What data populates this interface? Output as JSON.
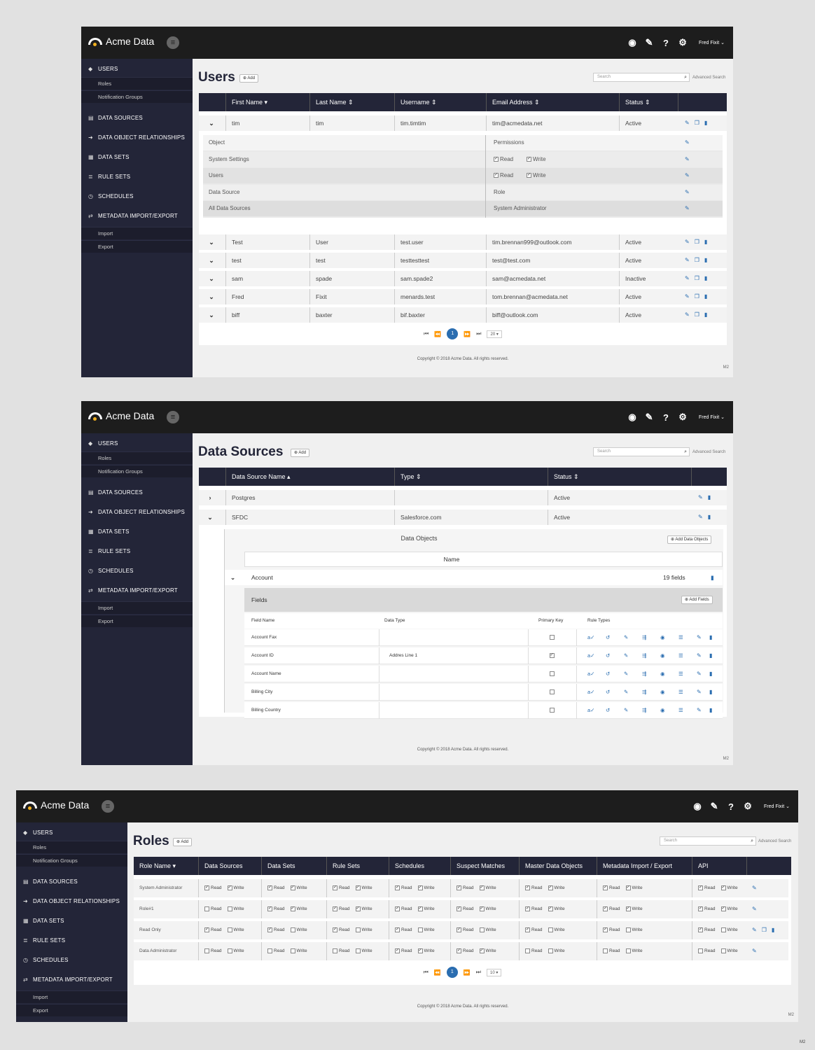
{
  "app": {
    "brand": "Acme Data",
    "user_menu": "Fred Fixit",
    "top_icons": [
      "dashboard-icon",
      "wand-icon",
      "help-icon",
      "settings-icon"
    ]
  },
  "sidebar": {
    "users": "USERS",
    "roles": "Roles",
    "notification_groups": "Notification Groups",
    "data_sources": "DATA SOURCES",
    "dor": "DATA OBJECT RELATIONSHIPS",
    "data_sets": "DATA SETS",
    "rule_sets": "RULE SETS",
    "schedules": "SCHEDULES",
    "metadata": "METADATA IMPORT/EXPORT",
    "import": "Import",
    "export": "Export"
  },
  "common": {
    "add": "Add",
    "search_placeholder": "Search",
    "advanced_search": "Advanced Search",
    "copyright": "Copyright ©  2018  Acme Data.   All rights reserved.",
    "m2": "M2"
  },
  "users_screen": {
    "title": "Users",
    "columns": [
      "First Name ▾",
      "Last Name ⇕",
      "Username ⇕",
      "Email Address ⇕",
      "Status ⇕"
    ],
    "expanded": {
      "first": "tim",
      "last": "tim",
      "username": "tim.timtim",
      "email": "tim@acmedata.net",
      "status": "Active"
    },
    "permissions": {
      "object_header": "Object",
      "permissions_header": "Permissions",
      "rows": [
        {
          "object": "System Settings",
          "read": "Read",
          "write": "Write"
        },
        {
          "object": "Users",
          "read": "Read",
          "write": "Write"
        }
      ],
      "ds_header": "Data Source",
      "role_header": "Role",
      "ds_row": {
        "source": "All Data Sources",
        "role": "System Administrator"
      }
    },
    "rows": [
      {
        "first": "Test",
        "last": "User",
        "username": "test.user",
        "email": "tim.brennan999@outlook.com",
        "status": "Active"
      },
      {
        "first": "test",
        "last": "test",
        "username": "testtesttest",
        "email": "test@test.com",
        "status": "Active"
      },
      {
        "first": "sam",
        "last": "spade",
        "username": "sam.spade2",
        "email": "sam@acmedata.net",
        "status": "Inactive"
      },
      {
        "first": "Fred",
        "last": "Fixit",
        "username": "menards.test",
        "email": "tom.brennan@acmedata.net",
        "status": "Active"
      },
      {
        "first": "biff",
        "last": "baxter",
        "username": "bif.baxter",
        "email": "biff@outlook.com",
        "status": "Active"
      }
    ],
    "page": "1",
    "page_size": "20"
  },
  "ds_screen": {
    "title": "Data Sources",
    "columns": [
      "Data Source Name ▴",
      "Type ⇕",
      "Status ⇕"
    ],
    "rows": [
      {
        "name": "Postgres",
        "type": "",
        "status": "Active"
      },
      {
        "name": "SFDC",
        "type": "Salesforce.com",
        "status": "Active"
      }
    ],
    "data_objects": "Data Objects",
    "add_data_objects": "Add Data Objects",
    "name_header": "Name",
    "object": {
      "name": "Account",
      "fields_count": "19 fields"
    },
    "fields_title": "Fields",
    "add_fields": "Add Fields",
    "field_columns": [
      "Field Name",
      "Data Type",
      "Primary Key",
      "Rule Types"
    ],
    "fields": [
      {
        "name": "Account Fax",
        "type": "",
        "pk": false
      },
      {
        "name": "Account ID",
        "type": "Addres Line 1",
        "pk": true
      },
      {
        "name": "Account Name",
        "type": "",
        "pk": false
      },
      {
        "name": "Billing City",
        "type": "",
        "pk": false
      },
      {
        "name": "Billing Country",
        "type": "",
        "pk": false
      }
    ]
  },
  "roles_screen": {
    "title": "Roles",
    "columns": [
      "Role Name ▾",
      "Data Sources",
      "Data Sets",
      "Rule Sets",
      "Schedules",
      "Suspect Matches",
      "Master Data Objects",
      "Metadata Import / Export",
      "API"
    ],
    "read": "Read",
    "write": "Write",
    "rows": [
      {
        "name": "System Administrator",
        "perms": [
          [
            1,
            1
          ],
          [
            1,
            1
          ],
          [
            1,
            1
          ],
          [
            1,
            1
          ],
          [
            1,
            1
          ],
          [
            1,
            1
          ],
          [
            1,
            1
          ],
          [
            1,
            1
          ]
        ]
      },
      {
        "name": "Role#1",
        "perms": [
          [
            0,
            0
          ],
          [
            1,
            1
          ],
          [
            1,
            1
          ],
          [
            1,
            1
          ],
          [
            1,
            1
          ],
          [
            1,
            1
          ],
          [
            1,
            1
          ],
          [
            1,
            1
          ]
        ]
      },
      {
        "name": "Read Only",
        "perms": [
          [
            1,
            0
          ],
          [
            1,
            0
          ],
          [
            1,
            0
          ],
          [
            1,
            0
          ],
          [
            1,
            0
          ],
          [
            1,
            0
          ],
          [
            1,
            0
          ],
          [
            1,
            0
          ]
        ]
      },
      {
        "name": "Data Administrator",
        "perms": [
          [
            0,
            0
          ],
          [
            0,
            0
          ],
          [
            0,
            0
          ],
          [
            1,
            1
          ],
          [
            1,
            1
          ],
          [
            0,
            0
          ],
          [
            0,
            0
          ],
          [
            0,
            0
          ]
        ]
      }
    ],
    "page": "1",
    "page_size": "10"
  },
  "footer_m2": "M2"
}
